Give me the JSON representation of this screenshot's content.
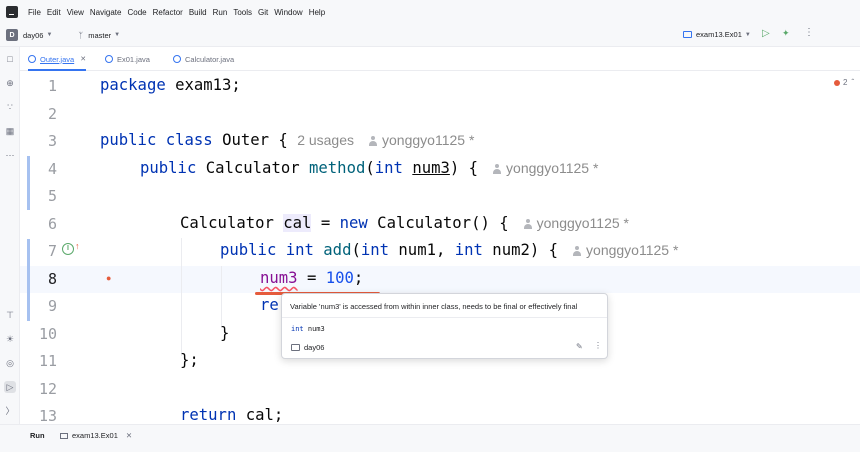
{
  "menu": [
    "File",
    "Edit",
    "View",
    "Navigate",
    "Code",
    "Refactor",
    "Build",
    "Run",
    "Tools",
    "Git",
    "Window",
    "Help"
  ],
  "toolbar": {
    "project_badge": "D",
    "project": "day06",
    "branch": "master",
    "run_config": "exam13.Ex01"
  },
  "tabs": [
    {
      "label": "Outer.java",
      "active": true
    },
    {
      "label": "Ex01.java",
      "active": false
    },
    {
      "label": "Calculator.java",
      "active": false
    }
  ],
  "problems": {
    "errors": "2"
  },
  "line_numbers": [
    "1",
    "2",
    "3",
    "4",
    "5",
    "6",
    "7",
    "8",
    "9",
    "10",
    "11",
    "12",
    "13"
  ],
  "code": {
    "l1": {
      "kw": "package",
      "rest": " exam13;"
    },
    "l3": {
      "kw1": "public",
      "kw2": "class",
      "name": " Outer { ",
      "usages": "2 usages",
      "author": "yonggyo1125 *"
    },
    "l4": {
      "kw": "public",
      "t1": " Calculator ",
      "fn": "method",
      "t2": "(",
      "kw2": "int",
      "param": "num3",
      "t3": ") {",
      "author": "yonggyo1125 *"
    },
    "l6": {
      "t1": "Calculator ",
      "var": "cal",
      "t2": " = ",
      "kw": "new",
      "t3": " Calculator() {",
      "author": "yonggyo1125 *"
    },
    "l7": {
      "kw": "public",
      "kw2": "int",
      "fn": "add",
      "t1": "(",
      "kw3": "int",
      "t2": " num1, ",
      "kw4": "int",
      "t3": " num2) {",
      "author": "yonggyo1125 *"
    },
    "l8": {
      "ident": "num3",
      "t1": " = ",
      "num": "100",
      "t2": ";"
    },
    "l9": {
      "partial": "re"
    },
    "l10": {
      "text": "}"
    },
    "l11": {
      "text": "};"
    },
    "l13": {
      "kw": "return",
      "rest": " cal;"
    }
  },
  "popup": {
    "message": "Variable 'num3' is accessed from within inner class, needs to be final or effectively final",
    "decl_type": "int",
    "decl_name": "num3",
    "module": "day06"
  },
  "bottom": {
    "run_label": "Run",
    "run_tab": "exam13.Ex01"
  },
  "colors": {
    "keyword": "#0033b3",
    "method": "#00627a",
    "number": "#1750eb",
    "error": "#e55b3c",
    "accent": "#3574f0"
  }
}
